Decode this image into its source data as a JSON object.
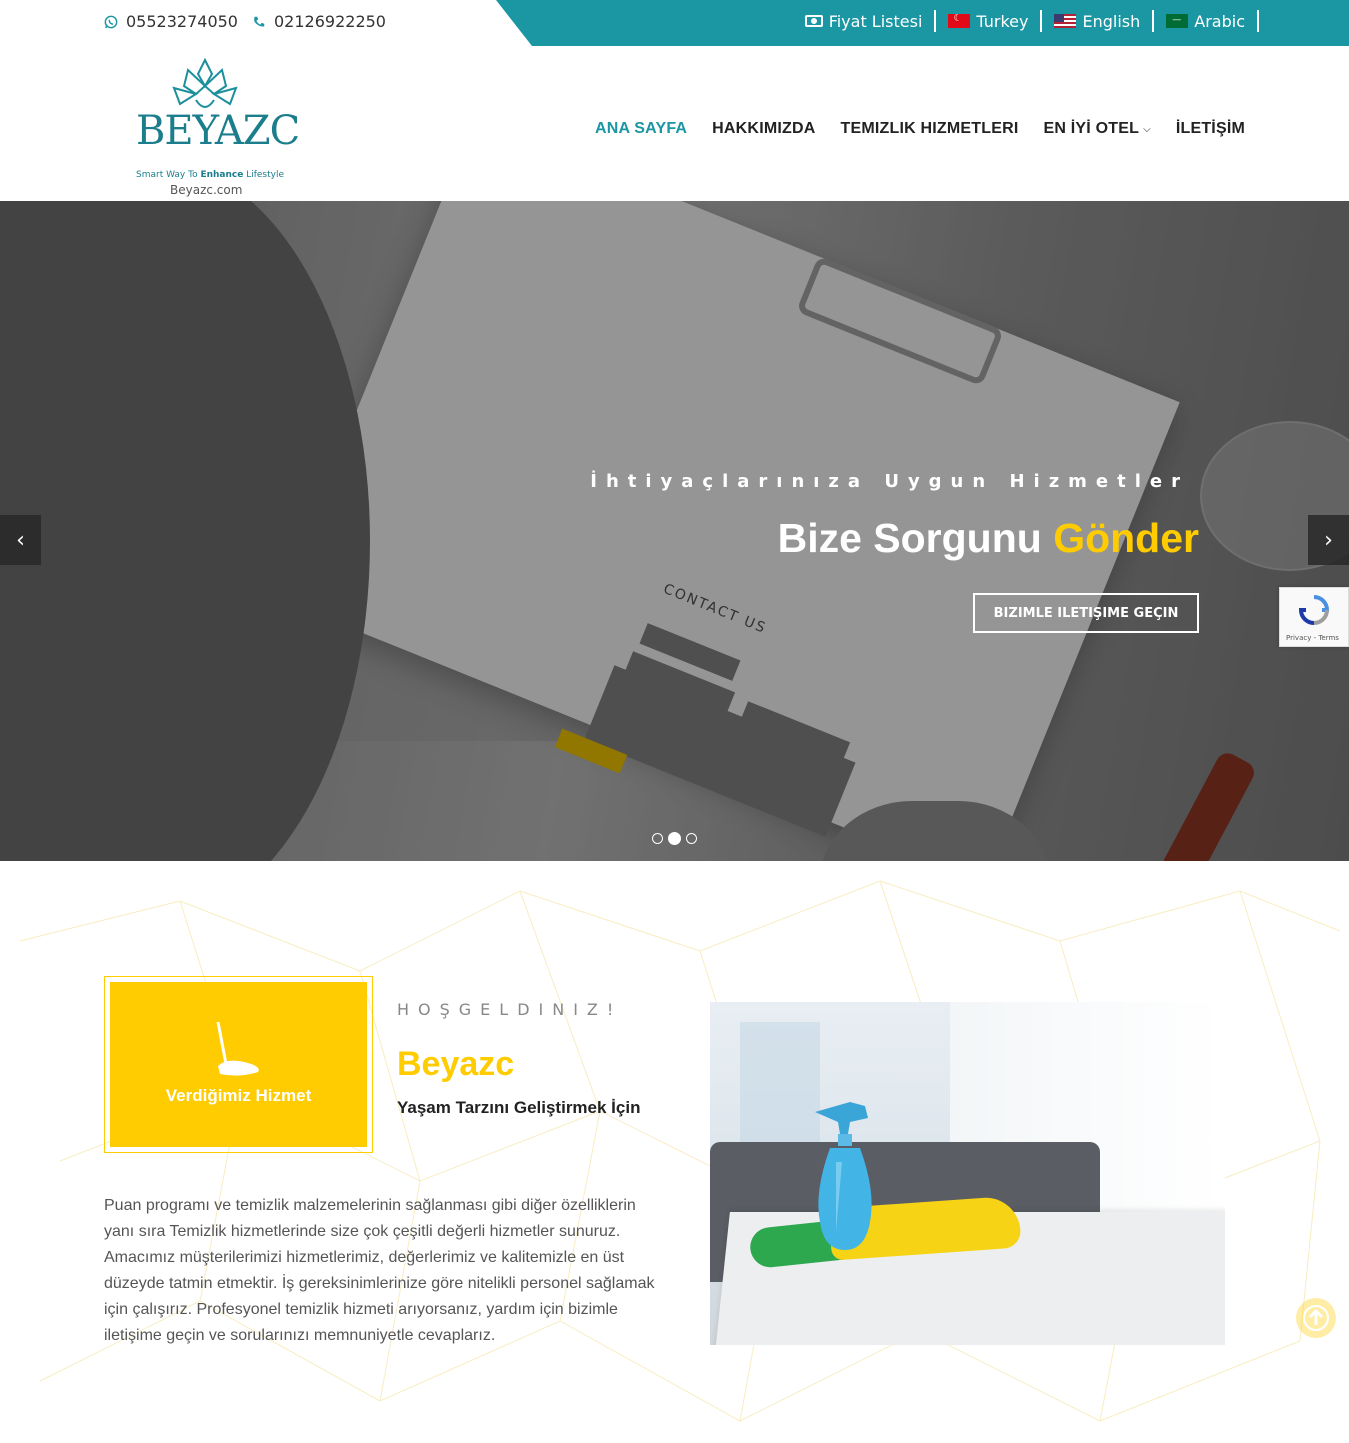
{
  "topbar": {
    "whatsapp": "05523274050",
    "phone": "02126922250",
    "links": [
      {
        "icon": "money-icon",
        "label": "Fiyat Listesi"
      },
      {
        "icon": "turkey-flag-icon",
        "label": "Turkey"
      },
      {
        "icon": "us-flag-icon",
        "label": "English"
      },
      {
        "icon": "saudi-flag-icon",
        "label": "Arabic"
      }
    ]
  },
  "logo": {
    "brand": "BEYAZC",
    "tagline_pre": "Smart Way To ",
    "tagline_bold": "Enhance",
    "tagline_post": " Lifestyle",
    "domain": "Beyazc.com"
  },
  "nav": {
    "items": [
      {
        "label": "ANA SAYFA",
        "active": true
      },
      {
        "label": "HAKKIMIZDA"
      },
      {
        "label": "TEMIZLIK HIZMETLERI"
      },
      {
        "label": "EN İYİ OTEL",
        "dropdown": true
      },
      {
        "label": "İLETİŞİM"
      }
    ]
  },
  "hero": {
    "subtitle": "İhtiyaçlarınıza Uygun Hizmetler",
    "title_pre": "Bize Sorgunu ",
    "title_accent": "Gönder",
    "cta": "BIZIMLE ILETIŞIME GEÇIN",
    "form_title": "CONTACT US",
    "slides": 3,
    "active_slide": 2
  },
  "recaptcha": {
    "terms": "Privacy - Terms"
  },
  "welcome": {
    "service_label": "Verdiğimiz Hizmet",
    "eyebrow": "HOŞGELDINIZ!",
    "brand": "Beyazc",
    "slogan": "Yaşam Tarzını Geliştirmek İçin",
    "body": "Puan programı ve temizlik malzemelerinin sağlanması gibi diğer özelliklerin yanı sıra Temizlik hizmetlerinde size çok çeşitli değerli hizmetler sunuruz. Amacımız müşterilerimizi hizmetlerimiz, değerlerimiz ve kalitemizle en üst düzeyde tatmin etmektir. İş gereksinimlerinize göre nitelikli personel sağlamak için çalışırız. Profesyonel temizlik hizmeti arıyorsanız, yardım için bizimle iletişime geçin ve sorularınızı memnuniyetle cevaplarız."
  },
  "colors": {
    "teal": "#1b96a3",
    "yellow": "#fecc00"
  }
}
